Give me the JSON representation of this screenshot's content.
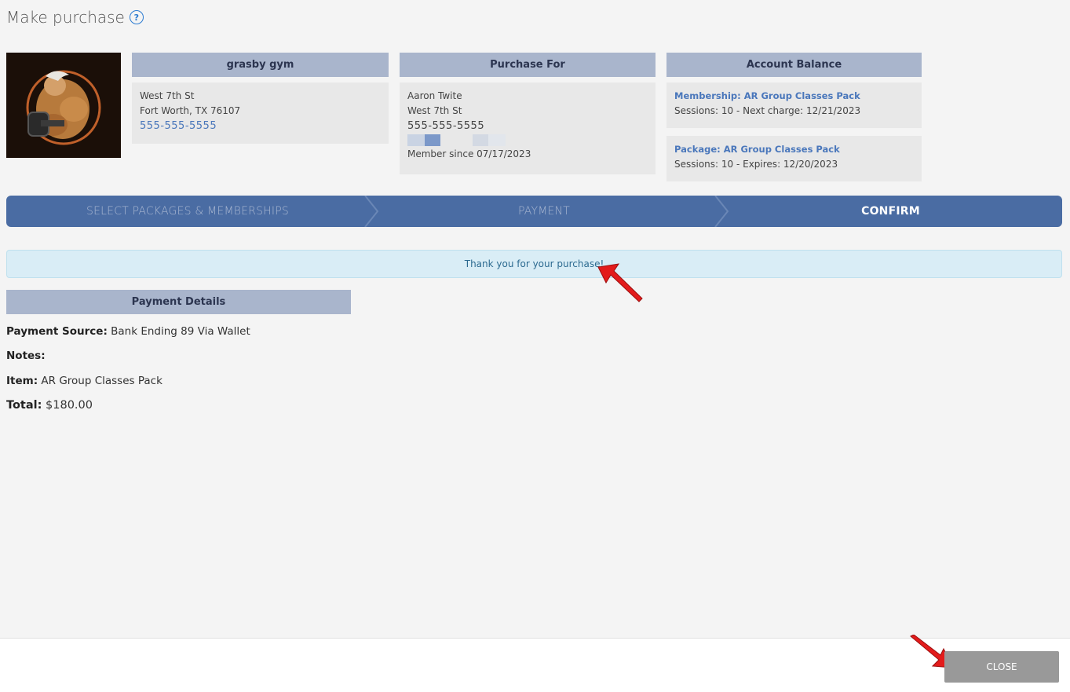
{
  "page": {
    "title": "Make purchase",
    "help_icon": "?"
  },
  "gym": {
    "name": "grasby gym",
    "address1": "West 7th St",
    "address2": "Fort Worth, TX 76107",
    "phone": "555-555-5555"
  },
  "purchase_for": {
    "header": "Purchase For",
    "name": "Aaron Twite",
    "address": "West 7th St",
    "phone": "555-555-5555",
    "member_since": "Member since 07/17/2023"
  },
  "account_balance": {
    "header": "Account Balance",
    "membership_title": "Membership: AR Group Classes Pack",
    "membership_detail": "Sessions: 10 -  Next charge: 12/21/2023",
    "package_title": "Package: AR Group Classes Pack",
    "package_detail": "Sessions: 10 -  Expires: 12/20/2023"
  },
  "steps": [
    {
      "label": "SELECT PACKAGES & MEMBERSHIPS",
      "state": "done"
    },
    {
      "label": "PAYMENT",
      "state": "done"
    },
    {
      "label": "CONFIRM",
      "state": "active"
    }
  ],
  "alert": {
    "message": "Thank you for your purchase!"
  },
  "payment_details": {
    "header": "Payment Details",
    "source_label": "Payment Source:",
    "source_value": "Bank Ending 89 Via Wallet",
    "notes_label": "Notes:",
    "notes_value": "",
    "item_label": "Item:",
    "item_value": "AR Group Classes Pack",
    "total_label": "Total:",
    "total_value": "$180.00"
  },
  "footer": {
    "close_label": "CLOSE"
  },
  "colors": {
    "step_bar": "#4a6ca3",
    "card_header": "#a9b5cc",
    "link": "#4a77bb",
    "alert_bg": "#d9edf6",
    "close_button": "#999999",
    "annotation_arrow": "#e31b1b"
  }
}
